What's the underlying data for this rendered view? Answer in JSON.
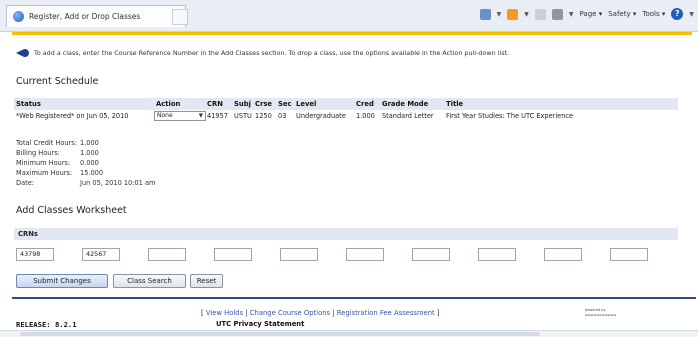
{
  "browser": {
    "tab_title": "Register, Add or Drop Classes",
    "menu": {
      "page": "Page",
      "safety": "Safety",
      "tools": "Tools",
      "help": "?"
    }
  },
  "info_message": "To add a class, enter the Course Reference Number in the Add Classes section. To drop a class, use the options available in the Action pull-down list.",
  "current_schedule": {
    "title": "Current Schedule",
    "headers": {
      "status": "Status",
      "action": "Action",
      "crn": "CRN",
      "subj": "Subj",
      "crse": "Crse",
      "sec": "Sec",
      "level": "Level",
      "cred": "Cred",
      "grade_mode": "Grade Mode",
      "title": "Title"
    },
    "rows": [
      {
        "status": "*Web Registered* on Jun 05, 2010",
        "action": "None",
        "crn": "41957",
        "subj": "USTU",
        "crse": "1250",
        "sec": "03",
        "level": "Undergraduate",
        "cred": "1.000",
        "grade_mode": "Standard Letter",
        "title": "First Year Studies: The UTC Experience"
      }
    ]
  },
  "summary": [
    {
      "label": "Total Credit Hours:",
      "value": "1.000"
    },
    {
      "label": "Billing Hours:",
      "value": "1.000"
    },
    {
      "label": "Minimum Hours:",
      "value": "0.000"
    },
    {
      "label": "Maximum Hours:",
      "value": "15.000"
    },
    {
      "label": "Date:",
      "value": "Jun 05, 2010 10:01 am"
    }
  ],
  "add_classes": {
    "title": "Add Classes Worksheet",
    "crn_header": "CRNs",
    "crn_values": [
      "43798",
      "42567",
      "",
      "",
      "",
      "",
      "",
      "",
      "",
      ""
    ]
  },
  "buttons": {
    "submit": "Submit Changes",
    "class_search": "Class Search",
    "reset": "Reset"
  },
  "footer": {
    "open_bracket": "[",
    "close_bracket": "]",
    "separator": "|",
    "view_holds": "View Holds",
    "change_course_options": "Change Course Options",
    "registration_fee": "Registration Fee Assessment",
    "release": "RELEASE: 8.2.1",
    "privacy": "UTC Privacy Statement",
    "powered_by": "powered by"
  }
}
